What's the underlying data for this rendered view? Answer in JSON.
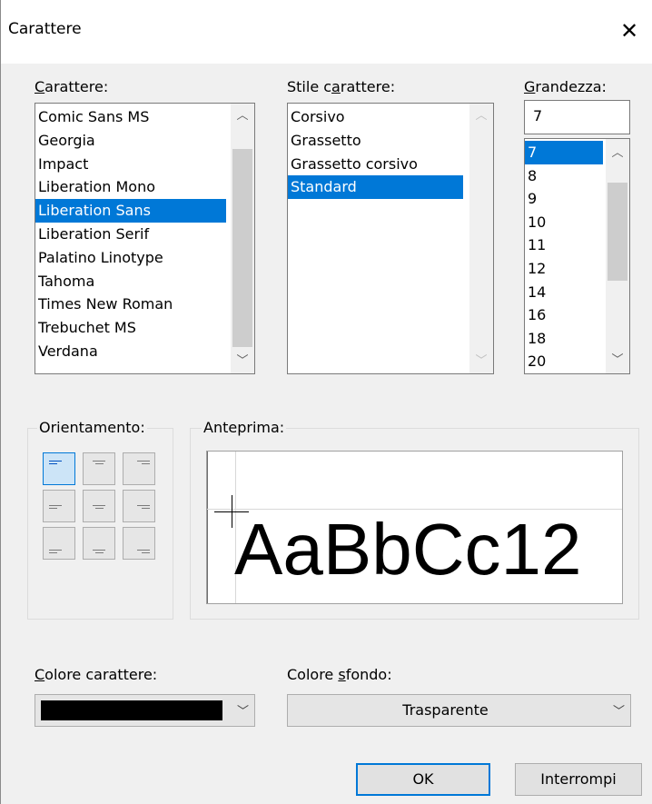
{
  "window": {
    "title": "Carattere",
    "close": "✕"
  },
  "font": {
    "label_pre": "",
    "label_key": "C",
    "label_post": "arattere:",
    "items": [
      "Comic Sans MS",
      "Georgia",
      "Impact",
      "Liberation Mono",
      "Liberation Sans",
      "Liberation Serif",
      "Palatino Linotype",
      "Tahoma",
      "Times New Roman",
      "Trebuchet MS",
      "Verdana"
    ],
    "selected": "Liberation Sans"
  },
  "style": {
    "label_pre": "Stile c",
    "label_key": "a",
    "label_post": "rattere:",
    "items": [
      "Corsivo",
      "Grassetto",
      "Grassetto corsivo",
      "Standard"
    ],
    "selected": "Standard"
  },
  "size": {
    "label_pre": "",
    "label_key": "G",
    "label_post": "randezza:",
    "value": "7",
    "items": [
      "7",
      "8",
      "9",
      "10",
      "11",
      "12",
      "14",
      "16",
      "18",
      "20"
    ],
    "selected": "7"
  },
  "orientation": {
    "label": "Orientamento:",
    "selected": "top-left"
  },
  "preview": {
    "label": "Anteprima:",
    "sample": "AaBbCc12"
  },
  "font_color": {
    "label_pre": "",
    "label_key": "C",
    "label_post": "olore carattere:",
    "value_color": "#000000"
  },
  "bg_color": {
    "label_pre": "Colore ",
    "label_key": "s",
    "label_post": "fondo:",
    "value": "Trasparente"
  },
  "buttons": {
    "ok": "OK",
    "cancel": "Interrompi"
  },
  "colors": {
    "selection": "#0078d7",
    "dialog_bg": "#f0f0f0"
  }
}
